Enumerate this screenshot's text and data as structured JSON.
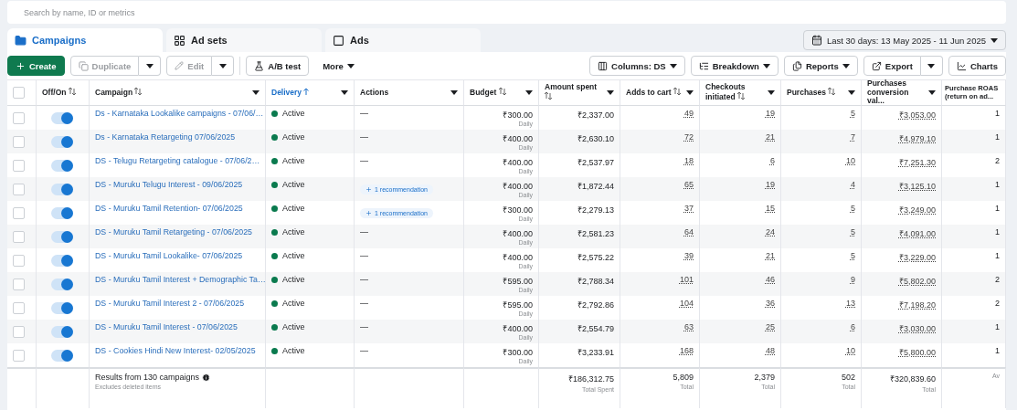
{
  "search": {
    "placeholder": "Search by name, ID or metrics"
  },
  "tabs": [
    {
      "label": "Campaigns",
      "kind": "campaigns",
      "selected": true
    },
    {
      "label": "Ad sets",
      "kind": "adsets",
      "selected": false
    },
    {
      "label": "Ads",
      "kind": "ads",
      "selected": false
    }
  ],
  "date_range": "Last 30 days: 13 May 2025 - 11 Jun 2025",
  "toolbar_left": [
    {
      "label": "Create",
      "kind": "create",
      "split": false,
      "disabled": false
    },
    {
      "label": "Duplicate",
      "kind": "duplicate",
      "split": true,
      "disabled": true
    },
    {
      "label": "Edit",
      "kind": "edit",
      "split": true,
      "disabled": true
    },
    {
      "label": "A/B test",
      "kind": "abtest",
      "split": false,
      "disabled": false
    },
    {
      "label": "More",
      "kind": "more",
      "split": false,
      "disabled": false
    }
  ],
  "toolbar_right": [
    {
      "label": "Columns: DS",
      "kind": "columns",
      "split": false
    },
    {
      "label": "Breakdown",
      "kind": "breakdown",
      "split": false
    },
    {
      "label": "Reports",
      "kind": "reports",
      "split": false
    },
    {
      "label": "Export",
      "kind": "export",
      "split": true
    },
    {
      "label": "Charts",
      "kind": "charts",
      "split": false
    }
  ],
  "table": {
    "select_all": {
      "checked": false
    },
    "columns": [
      {
        "label": "Off/On",
        "sortable": true,
        "sorted": false,
        "menu": false
      },
      {
        "label": "Campaign",
        "sortable": true,
        "sorted": false,
        "menu": true
      },
      {
        "label": "Delivery",
        "sortable": true,
        "sorted": true,
        "menu": true
      },
      {
        "label": "Actions",
        "sortable": false,
        "sorted": false,
        "menu": true
      },
      {
        "label": "Budget",
        "sortable": true,
        "sorted": false,
        "menu": true
      },
      {
        "label": "Amount spent",
        "sortable": true,
        "sorted": false,
        "menu": true
      },
      {
        "label": "Adds to cart",
        "sortable": true,
        "sorted": false,
        "menu": true
      },
      {
        "label": "Checkouts initiated",
        "sortable": true,
        "sorted": false,
        "menu": true
      },
      {
        "label": "Purchases",
        "sortable": true,
        "sorted": false,
        "menu": true
      },
      {
        "label": "Purchases conversion val...",
        "sortable": false,
        "sorted": false,
        "menu": true
      },
      {
        "label": "Purchase ROAS (return on ad...",
        "sortable": false,
        "sorted": false,
        "menu": false
      }
    ],
    "rows": [
      {
        "checked": false,
        "on": true,
        "campaign": "Ds - Karnataka Lookalike campaigns - 07/06/…",
        "delivery": "Active",
        "color": "#0a7a4e",
        "action": {
          "kind": "none",
          "text": "—"
        },
        "budget": "₹300.00",
        "budget_note": "Daily",
        "spent": "₹2,337.00",
        "adds": "49",
        "checkouts": "19",
        "purchases": "5",
        "conv_value": "₹3,053.00",
        "roas": "1"
      },
      {
        "checked": false,
        "on": true,
        "campaign": "Ds - Karnataka Retargeting 07/06/2025",
        "delivery": "Active",
        "color": "#0a7a4e",
        "action": {
          "kind": "none",
          "text": "—"
        },
        "budget": "₹400.00",
        "budget_note": "Daily",
        "spent": "₹2,630.10",
        "adds": "72",
        "checkouts": "21",
        "purchases": "7",
        "conv_value": "₹4,979.10",
        "roas": "1"
      },
      {
        "checked": false,
        "on": true,
        "campaign": "DS - Telugu Retargeting catalogue - 07/06/2…",
        "delivery": "Active",
        "color": "#0a7a4e",
        "action": {
          "kind": "none",
          "text": "—"
        },
        "budget": "₹400.00",
        "budget_note": "Daily",
        "spent": "₹2,537.97",
        "adds": "18",
        "checkouts": "6",
        "purchases": "10",
        "conv_value": "₹7,251.30",
        "roas": "2"
      },
      {
        "checked": false,
        "on": true,
        "campaign": "DS - Muruku Telugu Interest - 09/06/2025",
        "delivery": "Active",
        "color": "#0a7a4e",
        "action": {
          "kind": "recommendation",
          "text": "1 recommendation"
        },
        "budget": "₹400.00",
        "budget_note": "Daily",
        "spent": "₹1,872.44",
        "adds": "65",
        "checkouts": "19",
        "purchases": "4",
        "conv_value": "₹3,125.10",
        "roas": "1"
      },
      {
        "checked": false,
        "on": true,
        "campaign": "DS - Muruku Tamil Retention- 07/06/2025",
        "delivery": "Active",
        "color": "#0a7a4e",
        "action": {
          "kind": "recommendation",
          "text": "1 recommendation"
        },
        "budget": "₹300.00",
        "budget_note": "Daily",
        "spent": "₹2,279.13",
        "adds": "37",
        "checkouts": "15",
        "purchases": "5",
        "conv_value": "₹3,249.00",
        "roas": "1"
      },
      {
        "checked": false,
        "on": true,
        "campaign": "DS - Muruku Tamil Retargeting - 07/06/2025",
        "delivery": "Active",
        "color": "#0a7a4e",
        "action": {
          "kind": "none",
          "text": "—"
        },
        "budget": "₹400.00",
        "budget_note": "Daily",
        "spent": "₹2,581.23",
        "adds": "64",
        "checkouts": "24",
        "purchases": "5",
        "conv_value": "₹4,091.00",
        "roas": "1"
      },
      {
        "checked": false,
        "on": true,
        "campaign": "DS - Muruku Tamil Lookalike- 07/06/2025",
        "delivery": "Active",
        "color": "#0a7a4e",
        "action": {
          "kind": "none",
          "text": "—"
        },
        "budget": "₹400.00",
        "budget_note": "Daily",
        "spent": "₹2,575.22",
        "adds": "39",
        "checkouts": "21",
        "purchases": "5",
        "conv_value": "₹3,229.00",
        "roas": "1"
      },
      {
        "checked": false,
        "on": true,
        "campaign": "DS - Muruku Tamil Interest + Demographic Ta…",
        "delivery": "Active",
        "color": "#0a7a4e",
        "action": {
          "kind": "none",
          "text": "—"
        },
        "budget": "₹595.00",
        "budget_note": "Daily",
        "spent": "₹2,788.34",
        "adds": "101",
        "checkouts": "46",
        "purchases": "9",
        "conv_value": "₹5,802.00",
        "roas": "2"
      },
      {
        "checked": false,
        "on": true,
        "campaign": "DS - Muruku Tamil Interest 2 - 07/06/2025",
        "delivery": "Active",
        "color": "#0a7a4e",
        "action": {
          "kind": "none",
          "text": "—"
        },
        "budget": "₹595.00",
        "budget_note": "Daily",
        "spent": "₹2,792.86",
        "adds": "104",
        "checkouts": "36",
        "purchases": "13",
        "conv_value": "₹7,198.20",
        "roas": "2"
      },
      {
        "checked": false,
        "on": true,
        "campaign": "DS - Muruku Tamil Interest - 07/06/2025",
        "delivery": "Active",
        "color": "#0a7a4e",
        "action": {
          "kind": "none",
          "text": "—"
        },
        "budget": "₹400.00",
        "budget_note": "Daily",
        "spent": "₹2,554.79",
        "adds": "63",
        "checkouts": "25",
        "purchases": "6",
        "conv_value": "₹3,030.00",
        "roas": "1"
      },
      {
        "checked": false,
        "on": true,
        "campaign": "DS - Cookies Hindi New Interest- 02/05/2025",
        "delivery": "Active",
        "color": "#0a7a4e",
        "action": {
          "kind": "none",
          "text": "—"
        },
        "budget": "₹300.00",
        "budget_note": "Daily",
        "spent": "₹3,233.91",
        "adds": "168",
        "checkouts": "48",
        "purchases": "10",
        "conv_value": "₹5,800.00",
        "roas": "1"
      }
    ],
    "footer": {
      "results": "Results from 130 campaigns",
      "note": "Excludes deleted items",
      "totals": [
        {
          "value": "₹186,312.75",
          "label": "Total Spent"
        },
        {
          "value": "5,809",
          "label": "Total"
        },
        {
          "value": "2,379",
          "label": "Total"
        },
        {
          "value": "502",
          "label": "Total"
        },
        {
          "value": "₹320,839.60",
          "label": "Total"
        },
        {
          "label": "Av"
        }
      ]
    }
  }
}
